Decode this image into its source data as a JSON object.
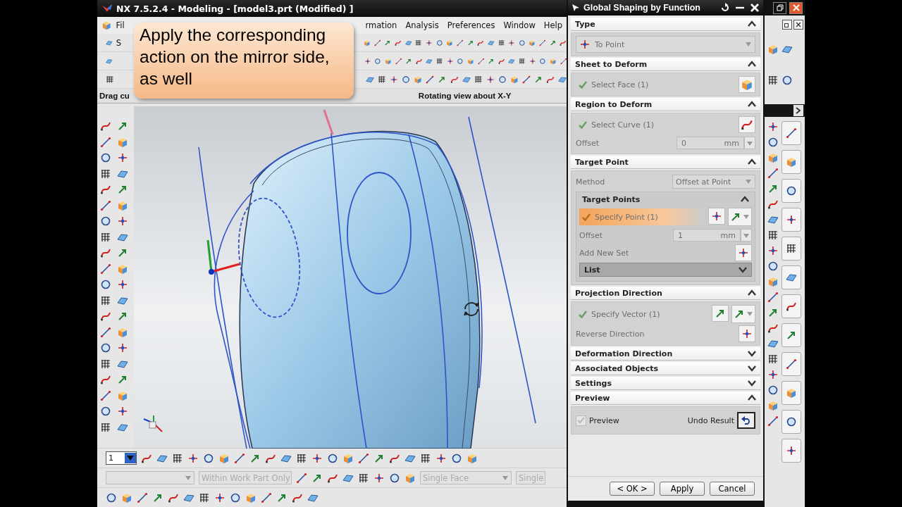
{
  "window": {
    "title": "NX 7.5.2.4 - Modeling - [model3.prt (Modified) ]"
  },
  "menu": [
    "Fil",
    "rmation",
    "Analysis",
    "Preferences",
    "Window",
    "Help"
  ],
  "toolbar": {
    "start_button": "S"
  },
  "callout": {
    "text": "Apply the corresponding action on the mirror side, as well"
  },
  "status": {
    "prompt": "Drag cu",
    "message": "Rotating view about X-Y"
  },
  "bottom_toolbar": {
    "layer": "1",
    "scope_filter": "Within Work Part Only",
    "face_rule": "Single Face",
    "curve_rule": "Single"
  },
  "dialog": {
    "title": "Global Shaping by Function",
    "sections": [
      {
        "title": "Type",
        "expanded": true,
        "rows": [
          {
            "kind": "dropdown",
            "value": "To Point"
          }
        ]
      },
      {
        "title": "Sheet to Deform",
        "expanded": true,
        "rows": [
          {
            "kind": "face",
            "label": "Select Face (1)",
            "done": true,
            "active": false
          }
        ]
      },
      {
        "title": "Region to Deform",
        "expanded": true,
        "rows": [
          {
            "kind": "curve",
            "label": "Select Curve (1)",
            "done": true,
            "active": false
          },
          {
            "kind": "field",
            "label": "Offset",
            "value": "0",
            "unit": "mm"
          }
        ]
      },
      {
        "title": "Target Point",
        "expanded": true,
        "rows": [
          {
            "kind": "choice",
            "label": "Method",
            "value": "Offset at Point"
          },
          {
            "kind": "group",
            "title": "Target Points",
            "expanded": true,
            "rows": [
              {
                "kind": "point",
                "label": "Specify Point (1)",
                "done": true,
                "active": true
              },
              {
                "kind": "field",
                "label": "Offset",
                "value": "1",
                "unit": "mm"
              },
              {
                "kind": "action",
                "label": "Add New Set"
              },
              {
                "kind": "list",
                "title": "List",
                "expanded": false
              }
            ]
          }
        ]
      },
      {
        "title": "Projection Direction",
        "expanded": true,
        "rows": [
          {
            "kind": "vector",
            "label": "Specify Vector (1)",
            "done": true,
            "active": false
          },
          {
            "kind": "action",
            "label": "Reverse Direction"
          }
        ]
      },
      {
        "title": "Deformation Direction",
        "expanded": false
      },
      {
        "title": "Associated Objects",
        "expanded": false
      },
      {
        "title": "Settings",
        "expanded": false
      },
      {
        "title": "Preview",
        "expanded": true,
        "rows": [
          {
            "kind": "preview",
            "label": "Preview",
            "checked": true,
            "undo_label": "Undo Result"
          }
        ]
      }
    ],
    "buttons": [
      "< OK >",
      "Apply",
      "Cancel"
    ]
  }
}
